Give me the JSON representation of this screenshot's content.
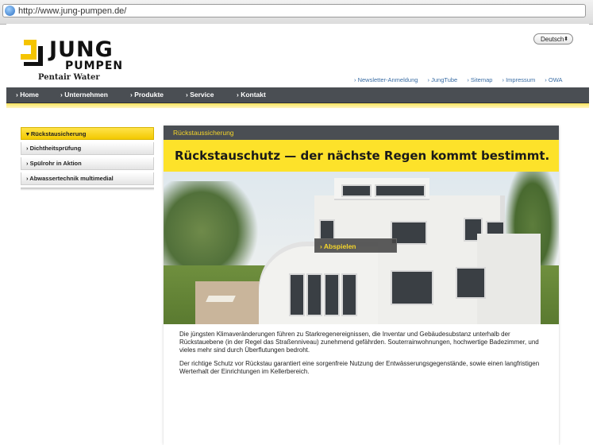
{
  "browser": {
    "url": "http://www.jung-pumpen.de/"
  },
  "logo": {
    "line1": "JUNG",
    "line2": "PUMPEN",
    "tagline": "Pentair Water"
  },
  "language": {
    "selected": "Deutsch"
  },
  "top_links": [
    "› Newsletter-Anmeldung",
    "› JungTube",
    "› Sitemap",
    "› Impressum",
    "› OWA"
  ],
  "nav": [
    "› Home",
    "› Unternehmen",
    "› Produkte",
    "› Service",
    "› Kontakt"
  ],
  "sidebar": {
    "items": [
      {
        "label": "▾ Rückstausicherung",
        "active": true
      },
      {
        "label": "› Dichtheitsprüfung",
        "active": false
      },
      {
        "label": "› Spülrohr in Aktion",
        "active": false
      },
      {
        "label": "› Abwassertechnik multimedial",
        "active": false
      }
    ]
  },
  "content": {
    "section_title": "Rückstaussicherung",
    "headline": "Rückstauschutz — der nächste Regen kommt bestimmt.",
    "play_label": "› Abspielen",
    "paragraphs": [
      "Die jüngsten Klimaveränderungen führen zu Starkregenereignissen, die Inventar und Gebäudesubstanz unterhalb der Rückstauebene (in der Regel das Straßenniveau) zunehmend gefährden. Souterrainwohnungen, hochwertige Badezimmer, und vieles mehr sind durch Überflutungen bedroht.",
      "Der richtige Schutz vor Rückstau garantiert eine sorgenfreie Nutzung der Entwässerungsgegenstände, sowie einen langfristigen Werterhalt der Einrichtungen im Kellerbereich."
    ]
  },
  "colors": {
    "accent_yellow": "#fde22a",
    "nav_dark": "#4a4e53",
    "link_blue": "#3b6ea5"
  }
}
